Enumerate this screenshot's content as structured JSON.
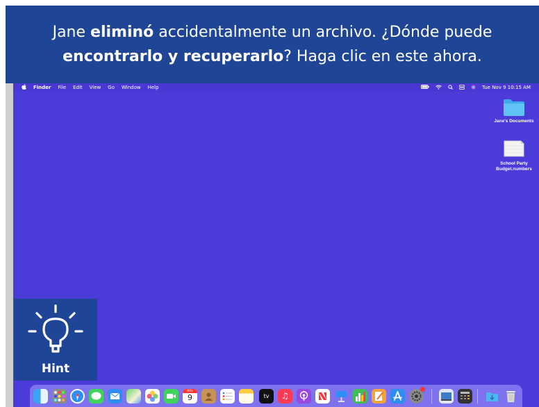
{
  "banner": {
    "part1": "Jane ",
    "part2": "eliminó",
    "part3": " accidentalmente un archivo. ¿Dónde puede",
    "part4": "encontrarlo y recuperarlo",
    "part5": "? Haga clic en este ahora."
  },
  "menubar": {
    "app_name": "Finder",
    "items": [
      "File",
      "Edit",
      "View",
      "Go",
      "Window",
      "Help"
    ],
    "clock": "Tue Nov 9  10:15 AM"
  },
  "desktop": {
    "folder_label": "Jane's Documents",
    "file_label_line1": "School Party",
    "file_label_line2": "Budget.numbers"
  },
  "hint": {
    "label": "Hint"
  },
  "dock": {
    "apps": [
      "finder-icon",
      "launchpad-icon",
      "safari-icon",
      "messages-icon",
      "mail-icon",
      "maps-icon",
      "photos-icon",
      "facetime-icon",
      "calendar-icon",
      "contacts-icon",
      "reminders-icon",
      "notes-icon",
      "apple-tv-icon",
      "music-icon",
      "podcasts-icon",
      "news-icon",
      "keynote-icon",
      "numbers-icon",
      "pages-icon",
      "app-store-icon",
      "system-preferences-icon",
      "preview-icon",
      "calculator-icon",
      "downloads-folder-icon",
      "trash-icon"
    ],
    "calendar_day": "9",
    "calendar_month": "NOV",
    "tv_label": "tv"
  },
  "colors": {
    "banner": "#1f4596",
    "desktop": "#4b3bd9",
    "hint": "#1f4596"
  }
}
